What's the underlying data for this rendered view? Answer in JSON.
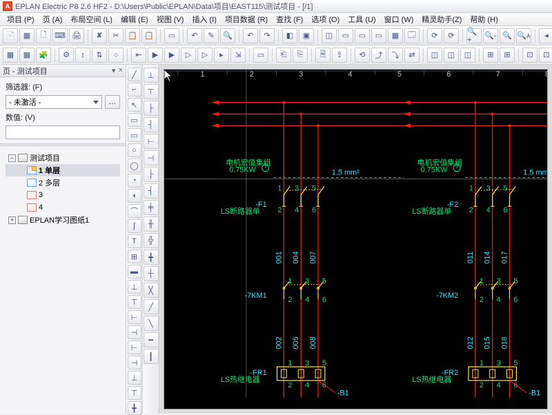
{
  "title": "EPLAN Electric P8 2.6 HF2 - D:\\Users\\Public\\EPLAN\\Data\\项目\\EAST115\\测试项目 - [/1]",
  "menu": [
    "项目 (P)",
    "页 (A)",
    "布局空间 (L)",
    "编辑 (E)",
    "视图 (V)",
    "插入 (I)",
    "项目数据 (R)",
    "查找 (F)",
    "选项 (O)",
    "工具 (U)",
    "窗口 (W)",
    "精灵助手(Z)",
    "帮助 (H)"
  ],
  "leftpanel": {
    "title": "页 - 测试项目",
    "filter_label": "筛选器: (F)",
    "filter_combo": "- 未激活 -",
    "filter_btn": "…",
    "value_label": "数值: (V)",
    "tree": {
      "projects": [
        {
          "name": "测试项目",
          "expanded": true,
          "pages": [
            {
              "label": "1 单层",
              "selected": true,
              "bold": true
            },
            {
              "label": "2 多层"
            },
            {
              "label": "3",
              "nb": true
            },
            {
              "label": "4",
              "nb": true
            }
          ]
        },
        {
          "name": "EPLAN学习图纸1",
          "expanded": false
        }
      ]
    }
  },
  "drawing": {
    "macro_label": "电机宏值集组",
    "power": "0.75KW",
    "wiresize": "1.5 mm²",
    "fuse_left": "-F1",
    "fuse_right": "-F2",
    "fuse_note": "LS断路器单",
    "contactor_left": "-7KM1",
    "contactor_right": "-7KM2",
    "relay_left": "-FR1",
    "relay_right": "-FR2",
    "relay_note": "LS热继电器",
    "wires_left": [
      "001",
      "004",
      "007",
      "002",
      "005",
      "008"
    ],
    "wires_right": [
      "011",
      "014",
      "017",
      "012",
      "015",
      "018"
    ],
    "minus_b": "-B1"
  }
}
